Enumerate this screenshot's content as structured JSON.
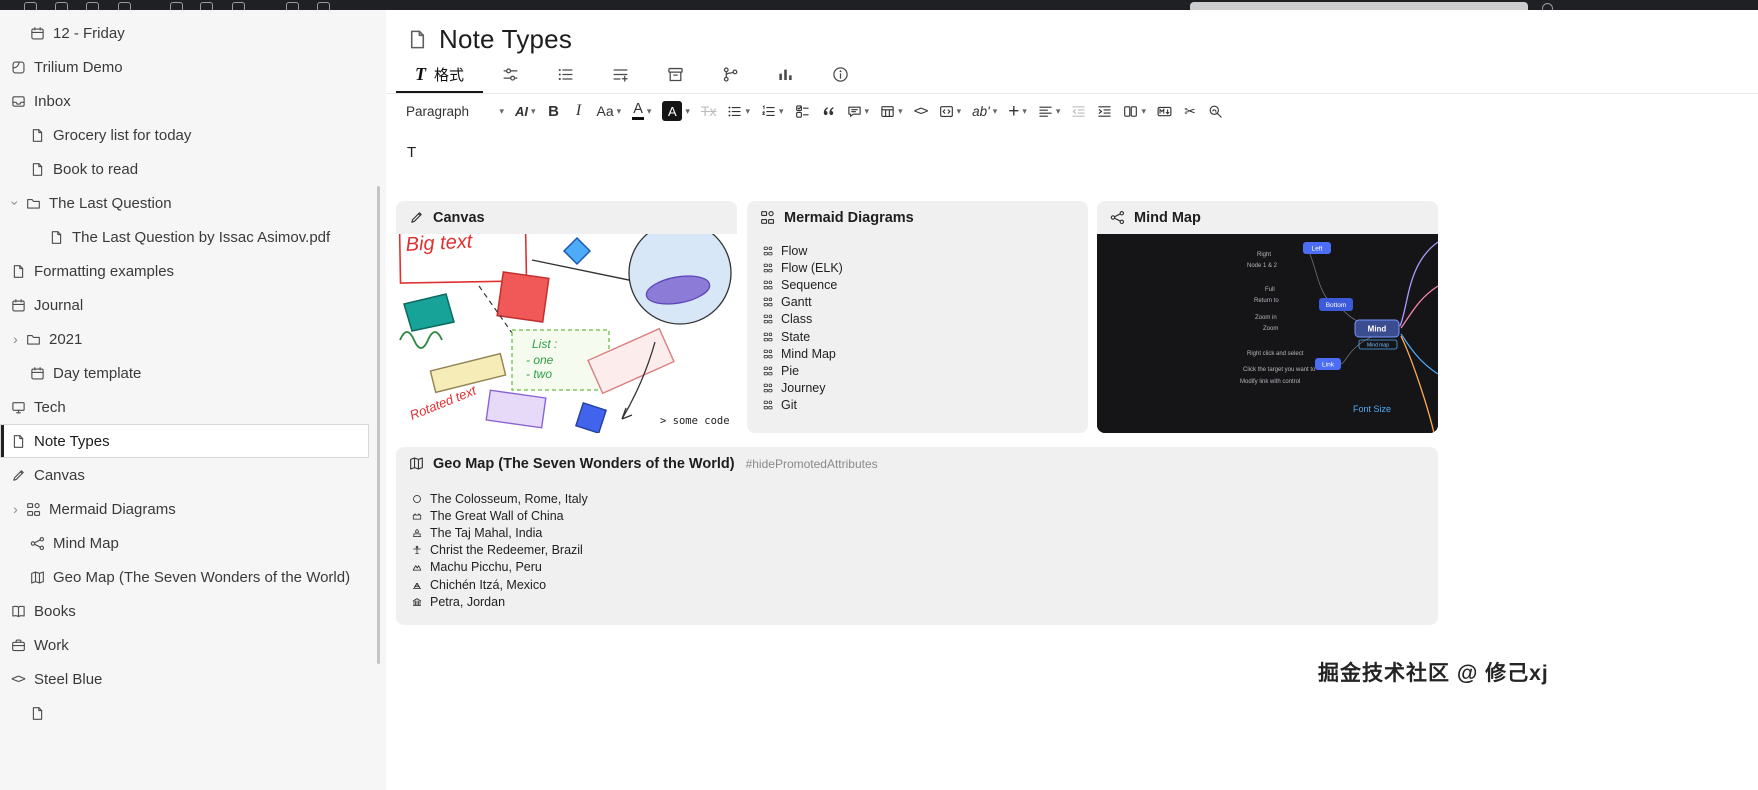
{
  "note": {
    "title": "Note Types",
    "icon": "note-icon",
    "content": "T"
  },
  "sidebar": {
    "items": [
      {
        "label": "12 - Friday",
        "icon": "calendar-icon",
        "indent": 1
      },
      {
        "label": "Trilium Demo",
        "icon": "fragment-icon",
        "indent": 0
      },
      {
        "label": "Inbox",
        "icon": "inbox-icon",
        "indent": 0
      },
      {
        "label": "Grocery list for today",
        "icon": "note-icon",
        "indent": 1
      },
      {
        "label": "Book to read",
        "icon": "note-icon",
        "indent": 1
      },
      {
        "label": "The Last Question",
        "icon": "folder-icon",
        "indent": 0,
        "chevron": "expanded"
      },
      {
        "label": "The Last Question by Issac Asimov.pdf",
        "icon": "pdf-icon",
        "indent": 2
      },
      {
        "label": "Formatting examples",
        "icon": "note-icon",
        "indent": 0
      },
      {
        "label": "Journal",
        "icon": "calendar-icon",
        "indent": 0
      },
      {
        "label": "2021",
        "icon": "folder-icon",
        "indent": 0,
        "chevron": "collapsed"
      },
      {
        "label": "Day template",
        "icon": "calendar-icon",
        "indent": 1
      },
      {
        "label": "Tech",
        "icon": "monitor-icon",
        "indent": 0
      },
      {
        "label": "Note Types",
        "icon": "note-icon",
        "indent": 0,
        "selected": true
      },
      {
        "label": "Canvas",
        "icon": "pencil-icon",
        "indent": 0
      },
      {
        "label": "Mermaid Diagrams",
        "icon": "diagram-icon",
        "indent": 0,
        "chevron": "collapsed"
      },
      {
        "label": "Mind Map",
        "icon": "mindmap-icon",
        "indent": 1
      },
      {
        "label": "Geo Map (The Seven Wonders of the World)",
        "icon": "map-icon",
        "indent": 1
      },
      {
        "label": "Books",
        "icon": "book-icon",
        "indent": 0
      },
      {
        "label": "Work",
        "icon": "briefcase-icon",
        "indent": 0
      },
      {
        "label": "Steel Blue",
        "icon": "code-icon",
        "indent": 0
      },
      {
        "label": "",
        "icon": "note-icon",
        "indent": 1
      }
    ]
  },
  "ribbon": {
    "tabs": [
      {
        "name": "tab-format",
        "icon": "format-T-icon",
        "label": "格式",
        "active": true
      },
      {
        "name": "tab-basic-properties",
        "icon": "sliders-icon"
      },
      {
        "name": "tab-owned-attributes",
        "icon": "list-icon"
      },
      {
        "name": "tab-inherited-attributes",
        "icon": "list-plus-icon"
      },
      {
        "name": "tab-note-paths",
        "icon": "archive-icon"
      },
      {
        "name": "tab-note-map",
        "icon": "branch-icon"
      },
      {
        "name": "tab-similar-notes",
        "icon": "chart-icon"
      },
      {
        "name": "tab-note-info",
        "icon": "info-icon"
      }
    ]
  },
  "toolbar": {
    "items": [
      {
        "name": "paragraph-dropdown",
        "label": "Paragraph",
        "chevron": true
      },
      {
        "name": "ai-dropdown",
        "label": "AI",
        "chevron": true
      },
      {
        "name": "bold-button",
        "label": "B"
      },
      {
        "name": "italic-button",
        "label": "I"
      },
      {
        "name": "font-size-dropdown",
        "label": "Aa",
        "chevron": true
      },
      {
        "name": "font-color-dropdown",
        "label": "A",
        "chevron": true
      },
      {
        "name": "background-color-dropdown",
        "label": "A",
        "chevron": true
      },
      {
        "name": "remove-format-button",
        "label": "Tx",
        "disabled": true
      },
      {
        "name": "bulleted-list-dropdown",
        "icon": "bulleted-list-icon",
        "chevron": true
      },
      {
        "name": "numbered-list-dropdown",
        "icon": "numbered-list-icon",
        "chevron": true
      },
      {
        "name": "todo-list-button",
        "icon": "todo-list-icon"
      },
      {
        "name": "block-quote-button",
        "icon": "quote-icon"
      },
      {
        "name": "admonition-dropdown",
        "icon": "admonition-icon",
        "chevron": true
      },
      {
        "name": "insert-table-dropdown",
        "icon": "table-icon",
        "chevron": true
      },
      {
        "name": "inline-code-button",
        "icon": "inline-code-icon"
      },
      {
        "name": "code-block-dropdown",
        "icon": "code-block-icon",
        "chevron": true
      },
      {
        "name": "subscript-dropdown",
        "label": "ab'",
        "chevron": true
      },
      {
        "name": "insert-dropdown",
        "label": "+",
        "chevron": true
      },
      {
        "name": "alignment-dropdown",
        "icon": "align-icon",
        "chevron": true
      },
      {
        "name": "outdent-button",
        "icon": "outdent-icon",
        "disabled": true
      },
      {
        "name": "indent-button",
        "icon": "indent-icon"
      },
      {
        "name": "layout-dropdown",
        "icon": "columns-icon",
        "chevron": true
      },
      {
        "name": "markdown-button",
        "icon": "markdown-icon"
      },
      {
        "name": "cut-to-note-button",
        "icon": "scissors-icon"
      },
      {
        "name": "find-replace-button",
        "icon": "find-replace-icon"
      }
    ]
  },
  "cards": [
    {
      "name": "canvas",
      "title": "Canvas",
      "icon": "pencil-icon"
    },
    {
      "name": "mermaid",
      "title": "Mermaid Diagrams",
      "icon": "diagram-icon",
      "items": [
        "Flow",
        "Flow (ELK)",
        "Sequence",
        "Gantt",
        "Class",
        "State",
        "Mind Map",
        "Pie",
        "Journey",
        "Git"
      ]
    },
    {
      "name": "mindmap",
      "title": "Mind Map",
      "icon": "mindmap-icon"
    },
    {
      "name": "geomap",
      "title": "Geo Map (The Seven Wonders of the World)",
      "icon": "map-icon",
      "badge": "#hidePromotedAttributes",
      "items": [
        {
          "label": "The Colosseum, Rome, Italy",
          "icon": "colosseum-icon"
        },
        {
          "label": "The Great Wall of China",
          "icon": "wall-icon"
        },
        {
          "label": "The Taj Mahal, India",
          "icon": "taj-mahal-icon"
        },
        {
          "label": "Christ the Redeemer, Brazil",
          "icon": "christ-icon"
        },
        {
          "label": "Machu Picchu, Peru",
          "icon": "mountain-icon"
        },
        {
          "label": "Chichén Itzá, Mexico",
          "icon": "pyramid-icon"
        },
        {
          "label": "Petra, Jordan",
          "icon": "petra-icon"
        }
      ]
    }
  ],
  "canvas": {
    "big_text": "Big text",
    "list_lines": [
      "List :",
      "- one",
      "- two"
    ],
    "rotated_text": "Rotated text",
    "code_text": "> some code"
  },
  "mindmap": {
    "center": "Mind",
    "labels": [
      "Left",
      "Right",
      "Node 1 & 2",
      "Full",
      "Return to",
      "Zoom in",
      "Zoom",
      "Bottom",
      "Mind map",
      "Right click and select",
      "Click the target you want to",
      "Modify link with control",
      "Link",
      "Font Size"
    ]
  },
  "watermark": "掘金技术社区 @ 修己xj"
}
